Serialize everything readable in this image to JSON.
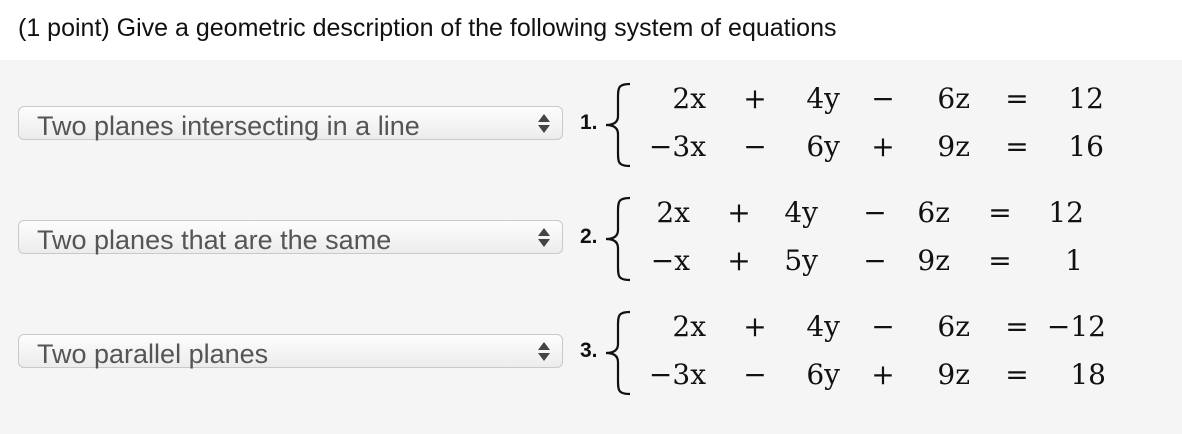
{
  "question": {
    "title": "(1 point) Give a geometric description of the following system of equations"
  },
  "problems": [
    {
      "number": "1.",
      "selected": "Two planes intersecting in a line",
      "equations": [
        {
          "t1": "2x",
          "op1": "+",
          "t2": "4y",
          "op2": "−",
          "t3": "6z",
          "eq": "=",
          "rhs": "12"
        },
        {
          "t1": "−3x",
          "op1": "−",
          "t2": "6y",
          "op2": "+",
          "t3": "9z",
          "eq": "=",
          "rhs": "16"
        }
      ]
    },
    {
      "number": "2.",
      "selected": "Two planes that are the same",
      "equations": [
        {
          "t1": "2x",
          "op1": "+",
          "t2": "4y",
          "op2": "−",
          "t3": "6z",
          "eq": "=",
          "rhs": "12"
        },
        {
          "t1": "−x",
          "op1": "+",
          "t2": "5y",
          "op2": "−",
          "t3": "9z",
          "eq": "=",
          "rhs": "1"
        }
      ]
    },
    {
      "number": "3.",
      "selected": "Two parallel planes",
      "equations": [
        {
          "t1": "2x",
          "op1": "+",
          "t2": "4y",
          "op2": "−",
          "t3": "6z",
          "eq": "=",
          "rhs": "−12"
        },
        {
          "t1": "−3x",
          "op1": "−",
          "t2": "6y",
          "op2": "+",
          "t3": "9z",
          "eq": "=",
          "rhs": "18"
        }
      ]
    }
  ],
  "icons": {
    "select_arrows": "up-down-arrows-icon",
    "brace": "left-curly-brace-icon"
  }
}
